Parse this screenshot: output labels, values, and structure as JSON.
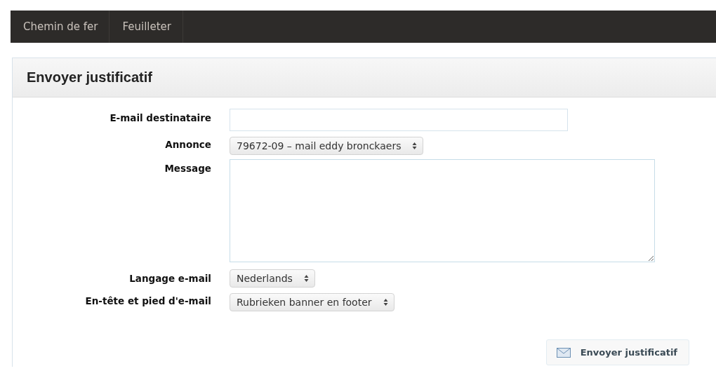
{
  "nav": {
    "items": [
      {
        "label": "Chemin de fer"
      },
      {
        "label": "Feuilleter"
      }
    ]
  },
  "panel": {
    "title": "Envoyer justificatif"
  },
  "form": {
    "fields": [
      {
        "label": "E-mail destinataire",
        "kind": "text"
      },
      {
        "label": "Annonce",
        "kind": "select",
        "value": "79672-09 – mail eddy bronckaers"
      },
      {
        "label": "Message",
        "kind": "textarea"
      },
      {
        "label": "Langage e-mail",
        "kind": "select",
        "value": "Nederlands"
      },
      {
        "label": "En-tête et pied d'e-mail",
        "kind": "select",
        "value": "Rubrieken banner en footer"
      }
    ]
  },
  "submit": {
    "label": "Envoyer justificatif"
  }
}
